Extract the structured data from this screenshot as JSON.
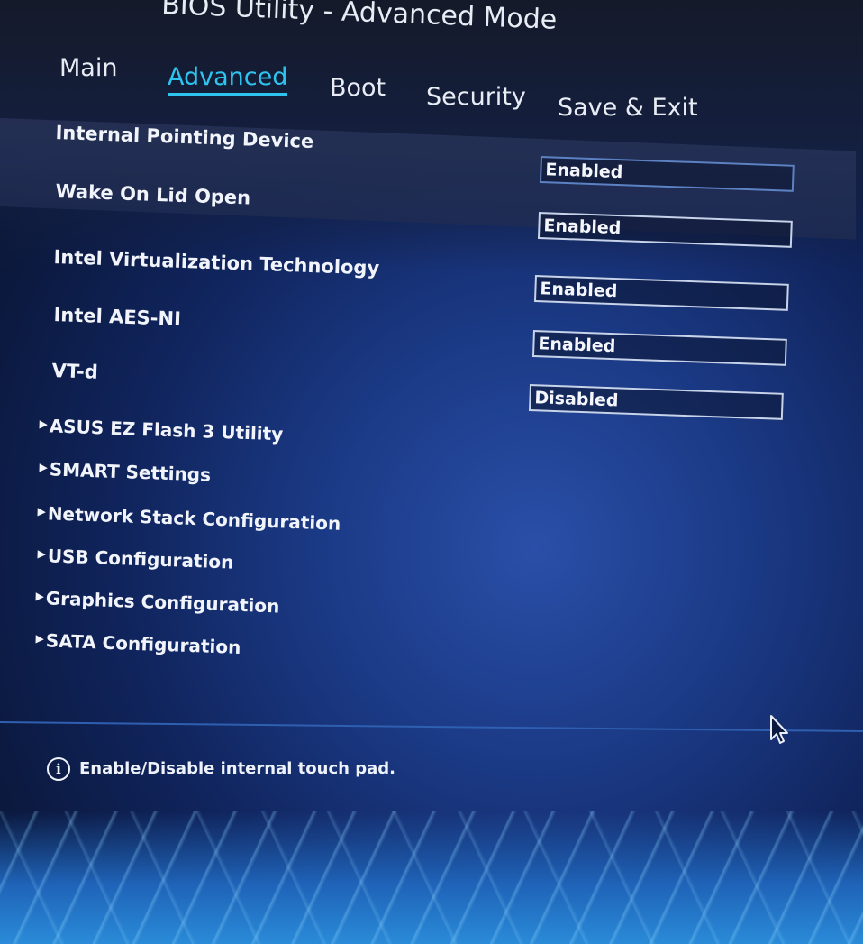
{
  "window": {
    "title": "BIOS Utility - Advanced Mode"
  },
  "tabs": [
    {
      "label": "Main",
      "active": false
    },
    {
      "label": "Advanced",
      "active": true
    },
    {
      "label": "Boot",
      "active": false
    },
    {
      "label": "Security",
      "active": false
    },
    {
      "label": "Save & Exit",
      "active": false
    }
  ],
  "settings": [
    {
      "label": "Internal Pointing Device",
      "value": "Enabled",
      "selected": true
    },
    {
      "label": "Wake On Lid Open",
      "value": "Enabled"
    },
    {
      "label": "Intel Virtualization Technology",
      "value": "Enabled"
    },
    {
      "label": "Intel AES-NI",
      "value": "Enabled"
    },
    {
      "label": "VT-d",
      "value": "Disabled"
    }
  ],
  "submenus": [
    {
      "label": "ASUS EZ Flash 3 Utility"
    },
    {
      "label": "SMART Settings"
    },
    {
      "label": "Network Stack Configuration"
    },
    {
      "label": "USB Configuration"
    },
    {
      "label": "Graphics Configuration"
    },
    {
      "label": "SATA Configuration"
    }
  ],
  "help": {
    "icon": "info-icon",
    "text": "Enable/Disable internal touch pad."
  },
  "colors": {
    "accent": "#2ec4f0",
    "background": "#1b3a86",
    "highlight": "#28345a"
  }
}
